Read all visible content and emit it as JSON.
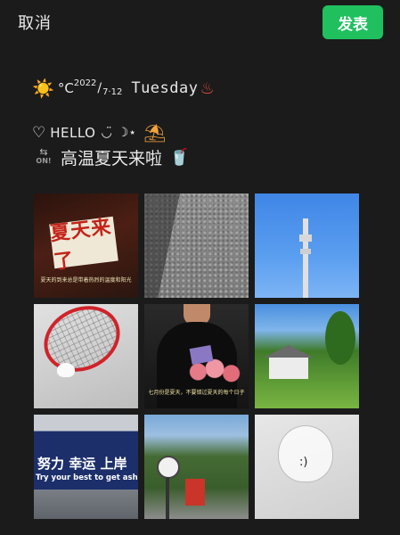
{
  "topbar": {
    "cancel_label": "取消",
    "publish_label": "发表"
  },
  "post": {
    "line1": {
      "weather_icon": "☀️",
      "deg": "°C",
      "year": "2022",
      "slash": "/",
      "date": "7·12",
      "weekday": "Tuesday",
      "spa_icon": "♨"
    },
    "line2": {
      "heart": "♡",
      "hello": "HELLO",
      "smile": "◡̈",
      "moon": "☽⋆",
      "beach_icon": "⛱"
    },
    "line3": {
      "arrows": "⇆",
      "on_label": "ON!",
      "text": "高温夏天来啦",
      "cup_icon": "🥤"
    }
  },
  "photos": [
    {
      "name": "summer-sign",
      "sign_text": "夏天来了",
      "caption": "夏天的到来总是带着热烈的温度和阳光"
    },
    {
      "name": "asphalt",
      "caption": ""
    },
    {
      "name": "sky-tower",
      "caption": ""
    },
    {
      "name": "badminton",
      "caption": ""
    },
    {
      "name": "flowers",
      "caption": "七月份是夏天，不要错过夏天的每个日子"
    },
    {
      "name": "countryside-house",
      "caption": ""
    },
    {
      "name": "station-sign",
      "line1": "努力 幸运 上岸",
      "line2": "Try your best to get ashore"
    },
    {
      "name": "tram-street",
      "caption": ""
    },
    {
      "name": "glass-face",
      "caption": ""
    }
  ]
}
